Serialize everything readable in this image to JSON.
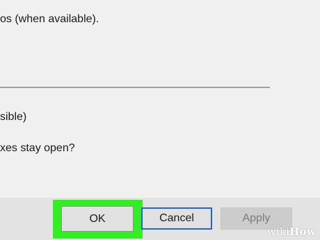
{
  "dialog": {
    "text_lines": [
      "os (when available).",
      "sible)",
      "xes stay open?"
    ]
  },
  "buttons": {
    "ok_label": "OK",
    "cancel_label": "Cancel",
    "apply_label": "Apply"
  },
  "watermark": {
    "part1": "wiki",
    "part2": "How"
  },
  "colors": {
    "highlight": "#33ee22",
    "focus_border": "#2463d1",
    "dialog_bg": "#f0f0f0",
    "button_bar_bg": "#e3e3e3"
  }
}
